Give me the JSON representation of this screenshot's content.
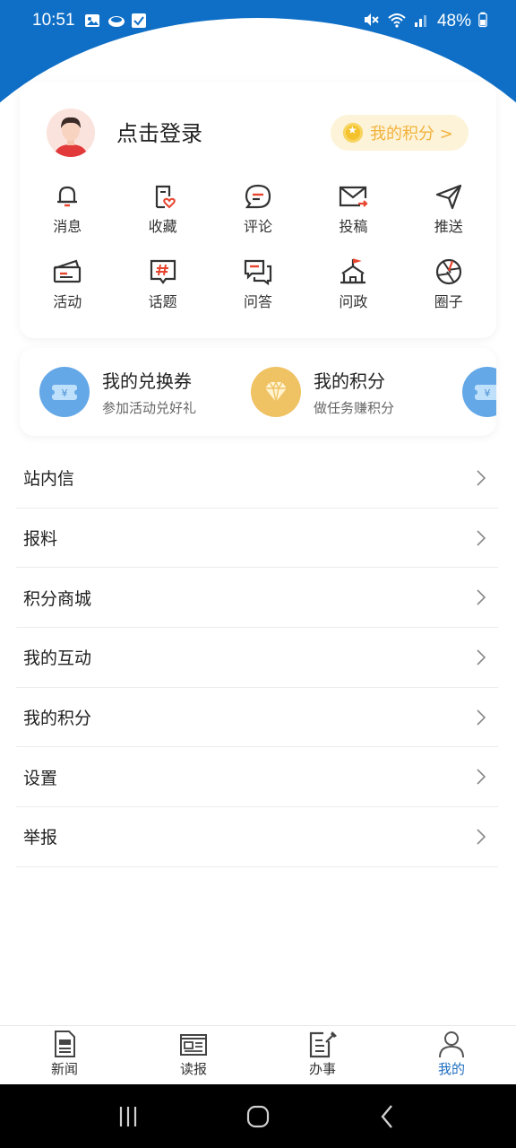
{
  "status_bar": {
    "time": "10:51",
    "battery": "48%",
    "left_icons": [
      "gallery-icon",
      "app-icon",
      "checkbox-icon"
    ],
    "right_icons": [
      "mute-icon",
      "wifi-icon",
      "signal-icon",
      "battery-icon"
    ]
  },
  "profile": {
    "login_label": "点击登录",
    "points_pill_label": "我的积分 >"
  },
  "quick_grid": [
    {
      "label": "消息",
      "icon": "bell-icon"
    },
    {
      "label": "收藏",
      "icon": "favorite-icon"
    },
    {
      "label": "评论",
      "icon": "comment-icon"
    },
    {
      "label": "投稿",
      "icon": "submit-mail-icon"
    },
    {
      "label": "推送",
      "icon": "send-icon"
    },
    {
      "label": "活动",
      "icon": "ticket-icon"
    },
    {
      "label": "话题",
      "icon": "hashtag-icon"
    },
    {
      "label": "问答",
      "icon": "qa-icon"
    },
    {
      "label": "问政",
      "icon": "government-icon"
    },
    {
      "label": "圈子",
      "icon": "circle-aperture-icon"
    }
  ],
  "promo_cards": [
    {
      "title": "我的兑换券",
      "subtitle": "参加活动兑好礼",
      "icon": "coupon-icon",
      "color": "#64a8e8"
    },
    {
      "title": "我的积分",
      "subtitle": "做任务赚积分",
      "icon": "diamond-icon",
      "color": "#efc264"
    },
    {
      "title": "",
      "subtitle": "",
      "icon": "coupon-icon",
      "color": "#64a8e8"
    }
  ],
  "menu": [
    {
      "label": "站内信"
    },
    {
      "label": "报料"
    },
    {
      "label": "积分商城"
    },
    {
      "label": "我的互动"
    },
    {
      "label": "我的积分"
    },
    {
      "label": "设置"
    },
    {
      "label": "举报"
    }
  ],
  "tabs": [
    {
      "label": "新闻",
      "icon": "news-icon",
      "active": false
    },
    {
      "label": "读报",
      "icon": "newspaper-icon",
      "active": false
    },
    {
      "label": "办事",
      "icon": "service-icon",
      "active": false
    },
    {
      "label": "我的",
      "icon": "profile-icon",
      "active": true
    }
  ],
  "colors": {
    "brand_blue": "#0f6fc6",
    "accent_red": "#e8442e",
    "gold": "#f2b23c",
    "active_tab": "#1f6fc0"
  }
}
